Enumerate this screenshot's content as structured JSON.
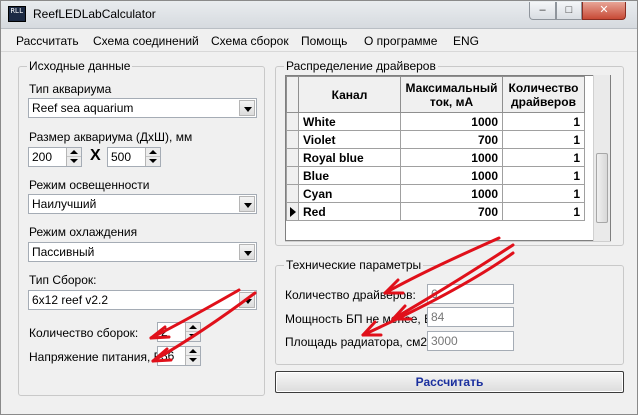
{
  "window": {
    "title": "ReefLEDLabCalculator",
    "app_icon_text": "RLL",
    "min_glyph": "–",
    "max_glyph": "□",
    "close_glyph": "✕"
  },
  "menu": [
    "Рассчитать",
    "Схема соединений",
    "Схема сборок",
    "Помощь",
    "О программе",
    "ENG"
  ],
  "input_group": {
    "title": "Исходные данные",
    "aquarium_type_label": "Тип аквариума",
    "aquarium_type_value": "Reef sea aquarium",
    "size_label": "Размер аквариума (ДхШ), мм",
    "size_length": "200",
    "size_times": "X",
    "size_width": "500",
    "lighting_mode_label": "Режим освещенности",
    "lighting_mode_value": "Наилучший",
    "cooling_mode_label": "Режим охлаждения",
    "cooling_mode_value": "Пассивный",
    "assembly_type_label": "Тип Сборок:",
    "assembly_type_value": "6x12 reef v2.2",
    "assembly_count_label": "Количество сборок:",
    "assembly_count_value": "2",
    "supply_voltage_label": "Напряжение питания, В:",
    "supply_voltage_value": "36"
  },
  "drivers_group": {
    "title": "Распределение драйверов",
    "columns": [
      "Канал",
      "Максимальный ток, мА",
      "Количество драйверов"
    ],
    "rows": [
      {
        "channel": "White",
        "max_current": "1000",
        "drivers": "1"
      },
      {
        "channel": "Violet",
        "max_current": "700",
        "drivers": "1"
      },
      {
        "channel": "Royal blue",
        "max_current": "1000",
        "drivers": "1"
      },
      {
        "channel": "Blue",
        "max_current": "1000",
        "drivers": "1"
      },
      {
        "channel": "Cyan",
        "max_current": "1000",
        "drivers": "1"
      },
      {
        "channel": "Red",
        "max_current": "700",
        "drivers": "1"
      }
    ]
  },
  "tech_group": {
    "title": "Технические параметры",
    "drivers_count_label": "Количество драйверов:",
    "drivers_count_value": "6",
    "psu_power_label": "Мощность БП не менее, Вт:",
    "psu_power_value": "84",
    "radiator_area_label": "Площадь радиатора, см2",
    "radiator_area_value": "3000"
  },
  "calculate_button": "Рассчитать",
  "colors": {
    "annotation_red": "#e0101a",
    "button_text": "#1a2f9e"
  }
}
